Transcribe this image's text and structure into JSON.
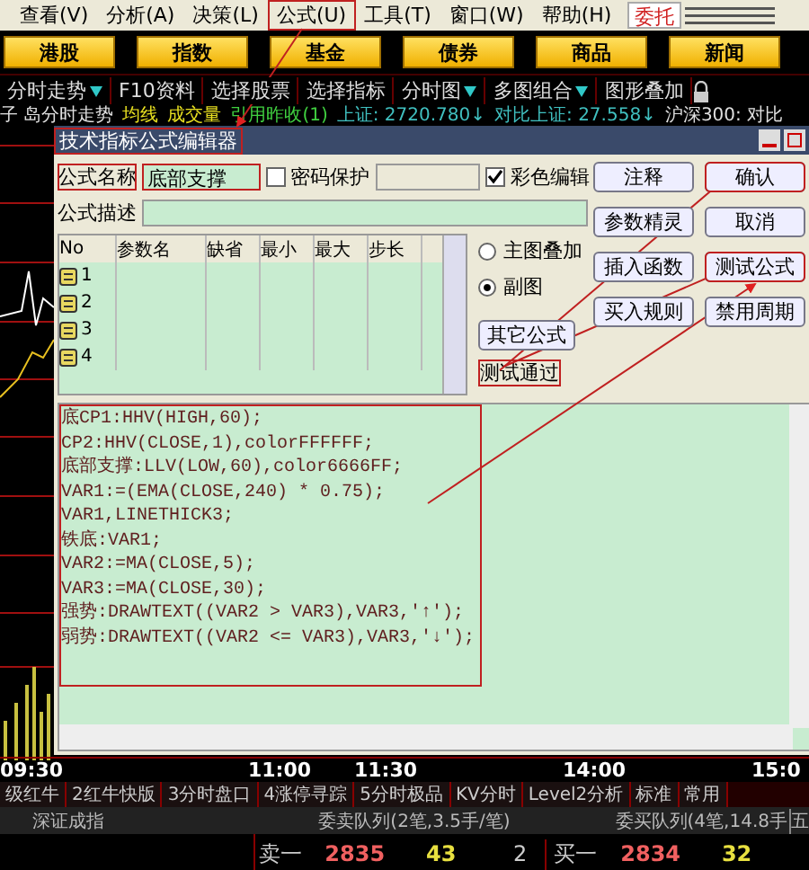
{
  "menu": [
    {
      "label": "查看(V)",
      "annotated": false
    },
    {
      "label": "分析(A)",
      "annotated": false
    },
    {
      "label": "决策(L)",
      "annotated": false
    },
    {
      "label": "公式(U)",
      "annotated": true
    },
    {
      "label": "工具(T)",
      "annotated": false
    },
    {
      "label": "窗口(W)",
      "annotated": false
    },
    {
      "label": "帮助(H)",
      "annotated": false
    }
  ],
  "trade_button": "委托",
  "market_buttons": [
    "港股",
    "指数",
    "基金",
    "债券",
    "商品",
    "新闻"
  ],
  "toolbar": [
    {
      "label": "分时走势",
      "dropdown": true
    },
    {
      "label": "F10资料",
      "dropdown": false
    },
    {
      "label": "选择股票",
      "dropdown": false
    },
    {
      "label": "选择指标",
      "dropdown": false
    },
    {
      "label": "分时图",
      "dropdown": true
    },
    {
      "label": "多图组合",
      "dropdown": true
    },
    {
      "label": "图形叠加",
      "dropdown": false
    }
  ],
  "info_line": [
    {
      "text": "子 岛分时走势",
      "color": "#e0e0e0"
    },
    {
      "text": "均线",
      "color": "#e8e020"
    },
    {
      "text": "成交量",
      "color": "#e8e020"
    },
    {
      "text": "引用昨收(1)",
      "color": "#40d040"
    },
    {
      "text": "上证: 2720.780↓",
      "color": "#40c0c0"
    },
    {
      "text": "对比上证: 27.558↓",
      "color": "#40c0c0"
    },
    {
      "text": "沪深300: 对比",
      "color": "#e0e0e0"
    }
  ],
  "dialog": {
    "title": "技术指标公式编辑器",
    "name_label": "公式名称",
    "name_value": "底部支撑",
    "password": {
      "label": "密码保护",
      "checked": false
    },
    "color_edit": {
      "label": "彩色编辑",
      "checked": true
    },
    "desc_label": "公式描述",
    "param_columns": [
      "No",
      "参数名",
      "缺省",
      "最小",
      "最大",
      "步长"
    ],
    "param_rows": [
      "1",
      "2",
      "3",
      "4"
    ],
    "chart_mode": [
      {
        "label": "主图叠加",
        "selected": false
      },
      {
        "label": "副图",
        "selected": true
      }
    ],
    "buttons": [
      {
        "label": "注释",
        "annotated": false
      },
      {
        "label": "确认",
        "annotated": true
      },
      {
        "label": "参数精灵",
        "annotated": false
      },
      {
        "label": "取消",
        "annotated": false
      },
      {
        "label": "插入函数",
        "annotated": false
      },
      {
        "label": "测试公式",
        "annotated": true
      },
      {
        "label": "其它公式",
        "annotated": false
      },
      {
        "label": "买入规则",
        "annotated": false
      },
      {
        "label": "禁用周期",
        "annotated": false
      }
    ],
    "status": "测试通过",
    "code": [
      "底CP1:HHV(HIGH,60);",
      "CP2:HHV(CLOSE,1),colorFFFFFF;",
      "底部支撑:LLV(LOW,60),color6666FF;",
      "VAR1:=(EMA(CLOSE,240) * 0.75);",
      "VAR1,LINETHICK3;",
      "铁底:VAR1;",
      "VAR2:=MA(CLOSE,5);",
      "VAR3:=MA(CLOSE,30);",
      "强势:DRAWTEXT((VAR2 > VAR3),VAR3,'↑');",
      "弱势:DRAWTEXT((VAR2 <= VAR3),VAR3,'↓');"
    ]
  },
  "time_axis": [
    "09:30",
    "11:00",
    "11:30",
    "14:00",
    "15:0"
  ],
  "bottom_tabs": [
    "级红牛",
    "2红牛快版",
    "3分时盘口",
    "4涨停寻踪",
    "5分时极品",
    "KV分时",
    "Level2分析",
    "标准",
    "常用"
  ],
  "quote_header": [
    "深证成指",
    "委卖队列(2笔,3.5手/笔)",
    "委买队列(4笔,14.8手",
    "五"
  ],
  "sell": {
    "label": "卖一",
    "price": "2835",
    "volume": "43",
    "count": "2"
  },
  "buy": {
    "label": "买一",
    "price": "2834",
    "volume": "32"
  }
}
